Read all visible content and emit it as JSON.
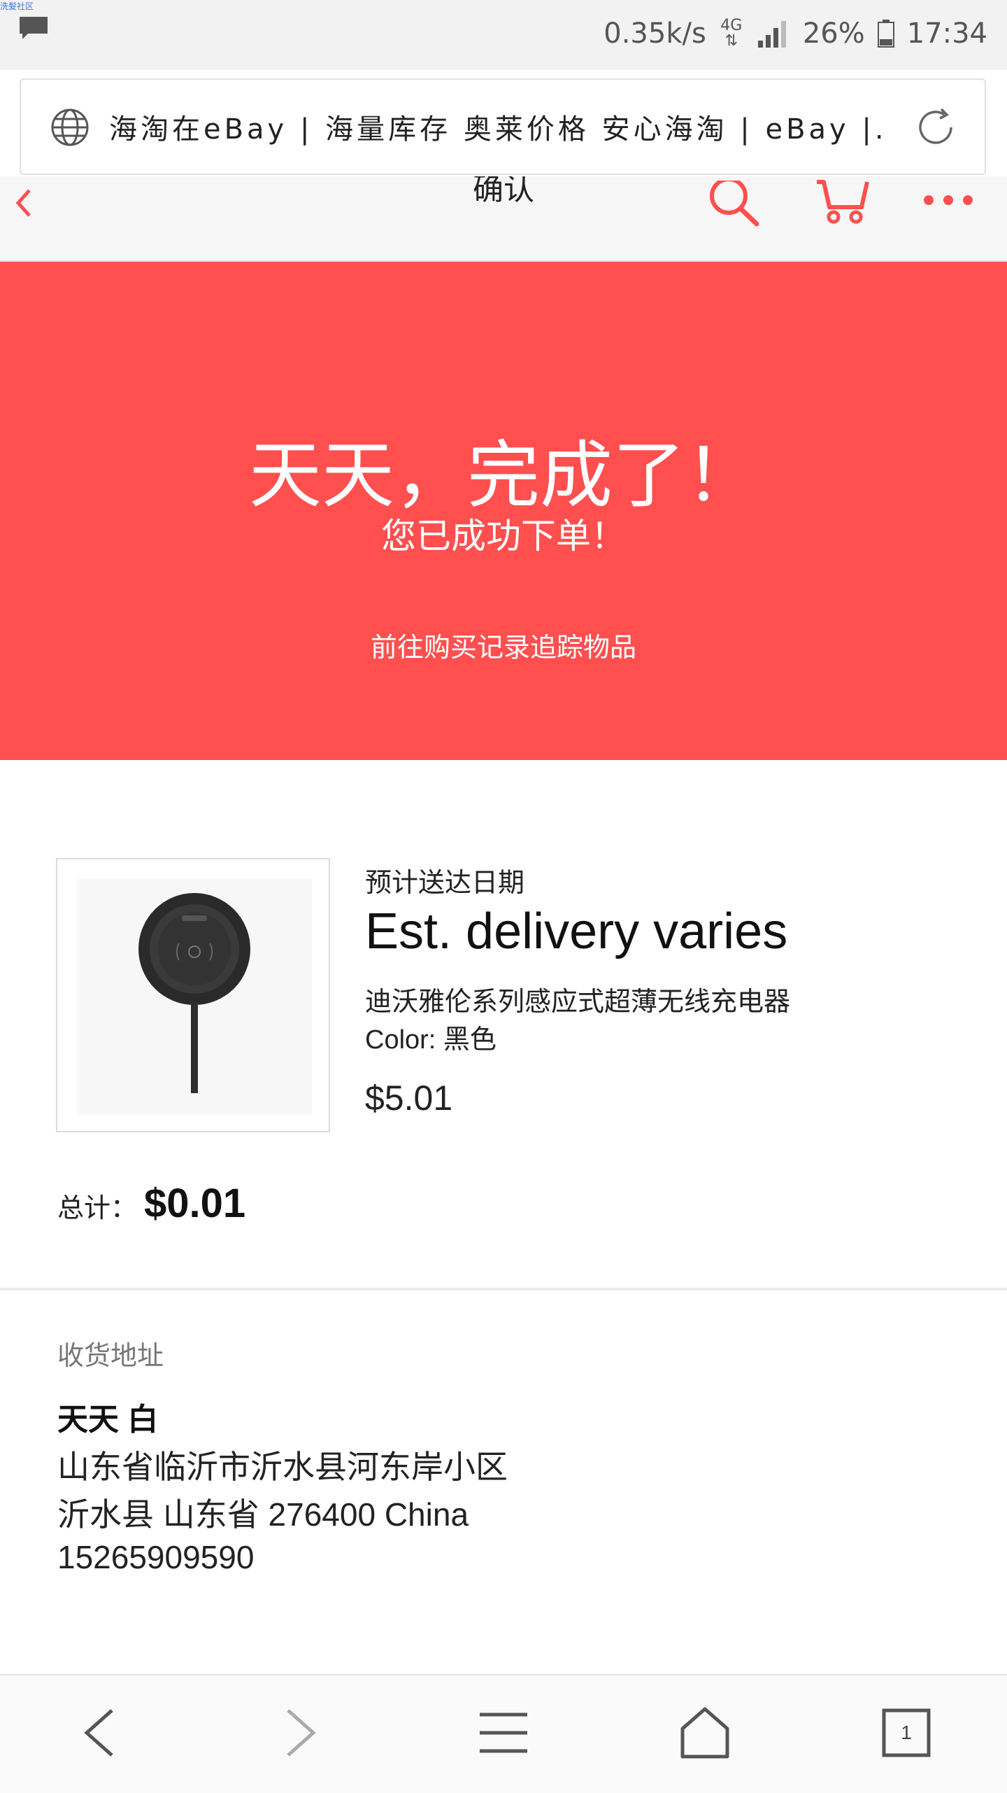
{
  "status_bar": {
    "tiny_text": "洗髮社区",
    "net_speed": "0.35k/s",
    "network_type": "4G",
    "battery": "26%",
    "time": "17:34"
  },
  "browser": {
    "url_title": "海淘在eBay | 海量库存 奥莱价格 安心海淘 | eBay |..."
  },
  "header": {
    "title": "确认"
  },
  "hero": {
    "title": "天天，完成了！",
    "subtitle": "您已成功下单！",
    "track_link": "前往购买记录追踪物品",
    "color": "#ff4f4f"
  },
  "order": {
    "eta_label": "预计送达日期",
    "eta_value": "Est. delivery varies",
    "item_title": "迪沃雅伦系列感应式超薄无线充电器",
    "item_color": "Color: 黑色",
    "item_price": "$5.01",
    "item_image_icon": "wireless-charger-icon",
    "total_label": "总计：",
    "total_value": "$0.01"
  },
  "address": {
    "label": "收货地址",
    "name": "天天 白",
    "line1": "山东省临沂市沂水县河东岸小区",
    "line2": "沂水县 山东省 276400 China",
    "phone": "15265909590"
  },
  "bottom_nav": {
    "tab_count": "1",
    "icons": [
      "back-icon",
      "forward-icon",
      "menu-icon",
      "home-icon",
      "tabs-icon"
    ]
  }
}
